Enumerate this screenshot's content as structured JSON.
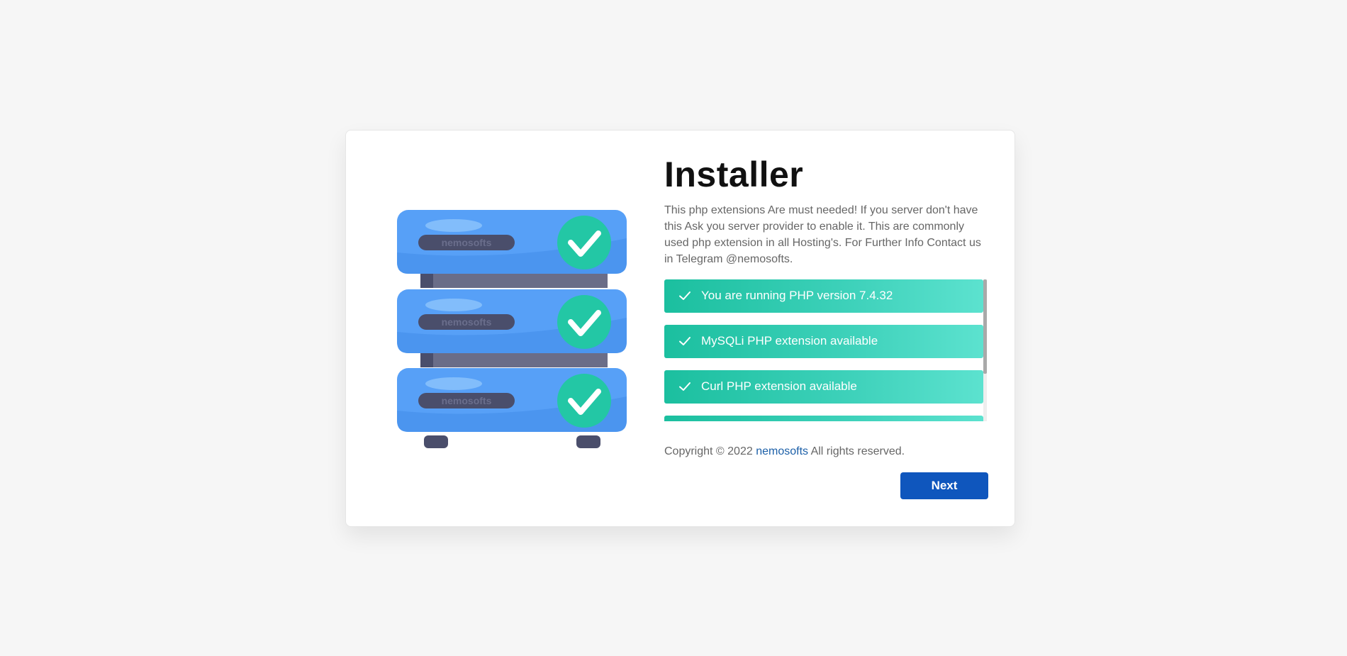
{
  "installer": {
    "title": "Installer",
    "description": "This php extensions Are must needed! If you server don't have this Ask you server provider to enable it. This are commonly used php extension in all Hosting's. For Further Info Contact us in Telegram @nemosofts.",
    "checks": [
      {
        "label": "You are running PHP version 7.4.32",
        "icon": "check-icon"
      },
      {
        "label": "MySQLi PHP extension available",
        "icon": "check-icon"
      },
      {
        "label": "Curl PHP extension available",
        "icon": "check-icon"
      },
      {
        "label": "",
        "icon": "check-icon"
      }
    ],
    "copyright_prefix": "Copyright © 2022",
    "copyright_link": "nemosofts",
    "copyright_suffix": "All rights reserved.",
    "next_label": "Next"
  },
  "illustration": {
    "server_label": "nemosofts",
    "server_color": "#57a0f7",
    "badge_color": "#23c7a5",
    "rack_color": "#4a4e6b"
  },
  "colors": {
    "accent": "#0f56bd",
    "success_start": "#1bbf9f",
    "success_end": "#5ce2cf",
    "link": "#1b5fa8"
  }
}
